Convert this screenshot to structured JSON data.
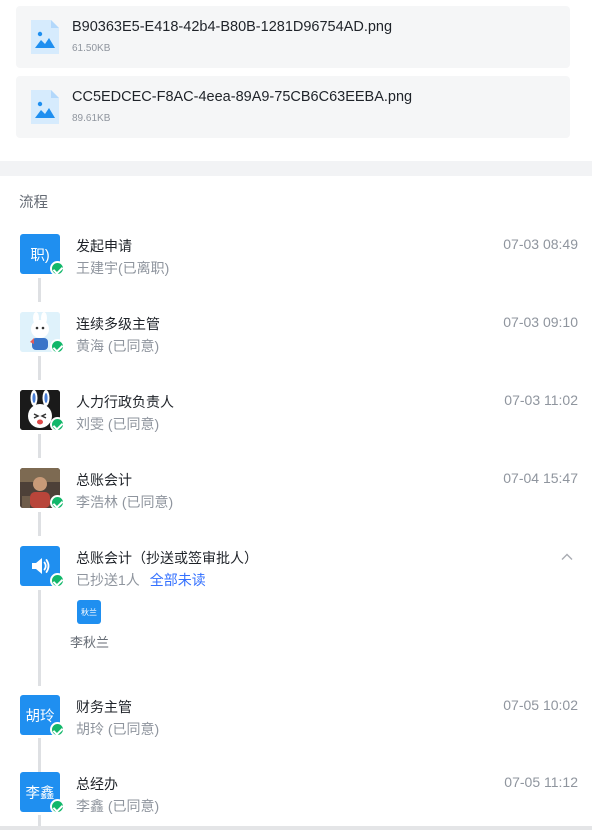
{
  "attachments": [
    {
      "name": "B90363E5-E418-42b4-B80B-1281D96754AD.png",
      "size": "61.50KB"
    },
    {
      "name": "CC5EDCEC-F8AC-4eea-89A9-75CB6C63EEBA.png",
      "size": "89.61KB"
    }
  ],
  "flow": {
    "title": "流程",
    "steps": [
      {
        "title": "发起申请",
        "sub": "王建宇(已离职)",
        "time": "07-03 08:49",
        "avatar_text": "职)"
      },
      {
        "title": "连续多级主管",
        "sub": "黄海 (已同意)",
        "time": "07-03 09:10"
      },
      {
        "title": "人力行政负责人",
        "sub": "刘雯 (已同意)",
        "time": "07-03 11:02"
      },
      {
        "title": "总账会计",
        "sub": "李浩林 (已同意)",
        "time": "07-04 15:47"
      },
      {
        "title": "总账会计（抄送或签审批人）",
        "sub": "已抄送1人",
        "link": "全部未读"
      },
      {
        "title": "财务主管",
        "sub": "胡玲 (已同意)",
        "time": "07-05 10:02",
        "avatar_text": "胡玲"
      },
      {
        "title": "总经办",
        "sub": "李鑫 (已同意)",
        "time": "07-05 11:12",
        "avatar_text": "李鑫"
      }
    ],
    "cc_person": {
      "avatar_text": "秋兰",
      "name": "李秋兰"
    }
  },
  "colors": {
    "accent": "#1f8ff0",
    "approved": "#12b76a",
    "link": "#3370ff"
  }
}
